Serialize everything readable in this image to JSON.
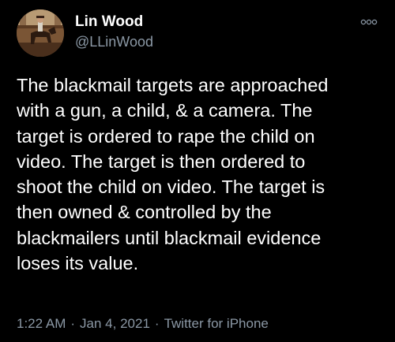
{
  "user": {
    "display_name": "Lin Wood",
    "handle": "@LLinWood",
    "avatar_icon": "avatar-horse-rider"
  },
  "header": {
    "more_icon": "more-options-icon"
  },
  "tweet": {
    "text": "The blackmail targets are approached\nwith a gun, a child, & a camera. The\ntarget is ordered to rape the child on\nvideo. The target is then ordered to\nshoot the child on video. The target is\nthen owned & controlled by the\nblackmailers until blackmail evidence\nloses its value."
  },
  "meta": {
    "time": "1:22 AM",
    "separator": "·",
    "date": "Jan 4, 2021",
    "source": "Twitter for iPhone"
  },
  "colors": {
    "background": "#000000",
    "text_primary": "#ffffff",
    "text_secondary": "#8b98a5"
  }
}
